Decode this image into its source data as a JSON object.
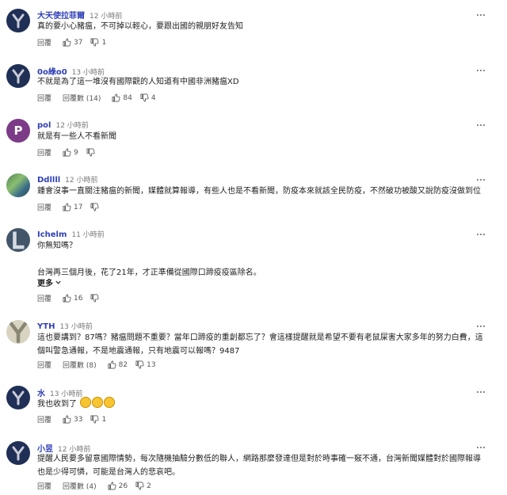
{
  "comments": [
    {
      "name": "大天使拉菲爾",
      "time": "12 小時前",
      "lines": [
        "真的要小心豬瘟，不可掉以輕心，要跟出國的親朋好友告知"
      ],
      "reply": "回覆",
      "reply_count": "",
      "likes": "37",
      "dislikes": "1",
      "avatar": "Y"
    },
    {
      "name": "0o綠o0",
      "time": "13 小時前",
      "lines": [
        "不就是為了這一堆沒有國際觀的人知道有中國非洲豬瘟XD"
      ],
      "reply": "回覆",
      "reply_count": "回覆數 (14)",
      "likes": "84",
      "dislikes": "4",
      "avatar": "Y"
    },
    {
      "name": "pol",
      "time": "12 小時前",
      "lines": [
        "就是有一些人不看新聞"
      ],
      "reply": "回覆",
      "reply_count": "",
      "likes": "9",
      "dislikes": "",
      "avatar": "P"
    },
    {
      "name": "Ddllll",
      "time": "12 小時前",
      "lines": [
        "鍾會沒事一直關注豬瘟的新聞，媒體就算報導，有些人也是不看新聞，防疫本來就該全民防疫，不然破功被酸又說防疫沒做到位"
      ],
      "reply": "回覆",
      "reply_count": "",
      "likes": "17",
      "dislikes": "",
      "avatar": "img"
    },
    {
      "name": "Ichelm",
      "time": "11 小時前",
      "lines": [
        "你無知嗎？",
        "",
        "台灣再三個月後，花了21年，才正準備從國際口蹄疫疫區除名。"
      ],
      "more": "更多",
      "reply": "回覆",
      "reply_count": "",
      "likes": "16",
      "dislikes": "",
      "avatar": "L"
    },
    {
      "name": "YTH",
      "time": "13 小時前",
      "lines": [
        "這也要講到？87嗎？豬瘟問題不重要？當年口蹄疫的重創都忘了？會這樣提醒就是希望不要有老鼠屎害大家多年的努力白費，這",
        "個叫警急通報，不是地震通報，只有地震可以報嗎？9487"
      ],
      "reply": "回覆",
      "reply_count": "回覆數 (8)",
      "likes": "82",
      "dislikes": "13",
      "avatar": "yth"
    },
    {
      "name": "水",
      "time": "13 小時前",
      "lines": [
        "我也收到了"
      ],
      "reply": "回覆",
      "reply_count": "",
      "likes": "33",
      "dislikes": "1",
      "avatar": "Y"
    },
    {
      "name": "小昱",
      "time": "12 小時前",
      "lines": [
        "提醒人民要多留意國際情勢，每次隨機抽驗分數低的聯人，網路那麼發達但是對於時事確一竅不通，台灣新聞媒體對於國際報導",
        "也是少得可憐，可能是台灣人的悲哀吧。"
      ],
      "reply": "回覆",
      "reply_count": "回覆數 (4)",
      "likes": "26",
      "dislikes": "2",
      "avatar": "Y"
    }
  ],
  "colors": {
    "name": "#2f3fb6",
    "avatar_y": "#1f2f55",
    "avatar_p": "#7c3b87",
    "avatar_l": "#425569"
  }
}
